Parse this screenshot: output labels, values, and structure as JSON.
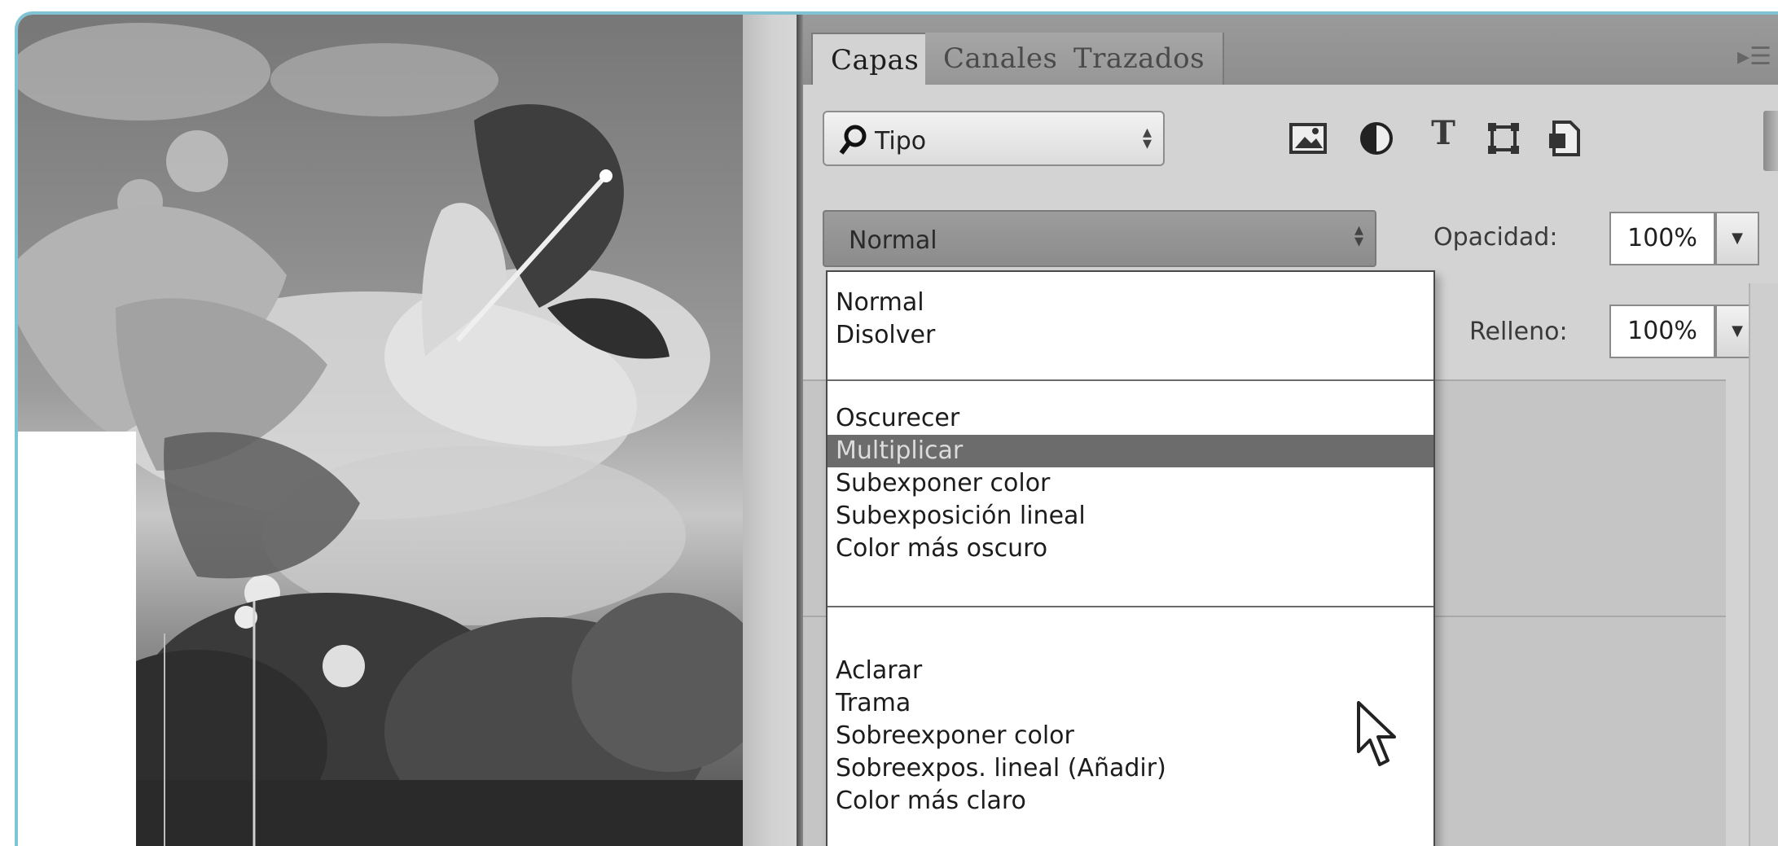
{
  "layers_panel": {
    "tabs": [
      {
        "label": "Capas",
        "active": true
      },
      {
        "label": "Canales",
        "active": false
      },
      {
        "label": "Trazados",
        "active": false
      }
    ],
    "filter": {
      "label": "Tipo",
      "icons": [
        "image-filter-icon",
        "adjustment-filter-icon",
        "type-filter-icon",
        "shape-filter-icon",
        "smart-object-filter-icon"
      ]
    },
    "blend_mode": {
      "selected": "Normal",
      "options": {
        "group1": [
          "Normal",
          "Disolver"
        ],
        "group2": [
          "Oscurecer",
          "Multiplicar",
          "Subexponer color",
          "Subexposición lineal",
          "Color más oscuro"
        ],
        "group3": [
          "Aclarar",
          "Trama",
          "Sobreexponer color",
          "Sobreexpos. lineal (Añadir)",
          "Color más claro"
        ]
      },
      "highlighted": "Multiplicar"
    },
    "opacity": {
      "label": "Opacidad:",
      "value": "100%"
    },
    "fill": {
      "label": "Relleno:",
      "value": "100%"
    },
    "type_icon_glyph": "T"
  },
  "colors": {
    "frame_border": "#7fc3d4",
    "highlight": "#6c6c6c",
    "panel_bg": "#d3d3d3"
  }
}
